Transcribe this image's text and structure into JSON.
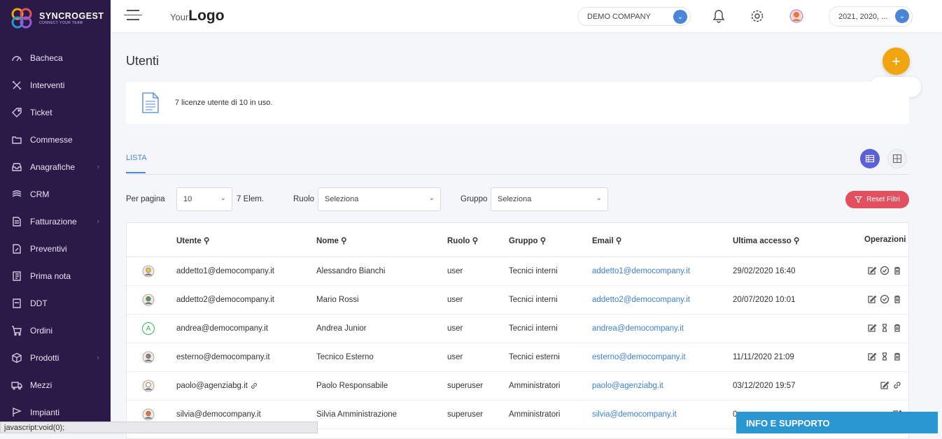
{
  "brand": {
    "name": "SYNCROGEST",
    "tagline": "CONNECT YOUR TEAM"
  },
  "sidebar": {
    "items": [
      {
        "label": "Bacheca",
        "icon": "dashboard-icon",
        "chevron": false
      },
      {
        "label": "Interventi",
        "icon": "tools-icon",
        "chevron": false
      },
      {
        "label": "Ticket",
        "icon": "tag-icon",
        "chevron": false
      },
      {
        "label": "Commesse",
        "icon": "folder-icon",
        "chevron": false
      },
      {
        "label": "Anagrafiche",
        "icon": "inbox-icon",
        "chevron": true
      },
      {
        "label": "CRM",
        "icon": "crm-icon",
        "chevron": false
      },
      {
        "label": "Fatturazione",
        "icon": "document-icon",
        "chevron": true
      },
      {
        "label": "Preventivi",
        "icon": "edit-doc-icon",
        "chevron": false
      },
      {
        "label": "Prima nota",
        "icon": "notebook-icon",
        "chevron": false
      },
      {
        "label": "DDT",
        "icon": "ddt-icon",
        "chevron": false
      },
      {
        "label": "Ordini",
        "icon": "cart-icon",
        "chevron": false
      },
      {
        "label": "Prodotti",
        "icon": "box-icon",
        "chevron": true
      },
      {
        "label": "Mezzi",
        "icon": "truck-icon",
        "chevron": false
      },
      {
        "label": "Impianti",
        "icon": "flag-icon",
        "chevron": false
      }
    ]
  },
  "topbar": {
    "logo_light": "Your",
    "logo_bold": "Logo",
    "company": "DEMO COMPANY",
    "years": "2021, 2020, ..."
  },
  "page": {
    "title": "Utenti",
    "new_label": "Nuovo",
    "license_text": "7 licenze utente di 10 in uso.",
    "tab": "LISTA"
  },
  "filters": {
    "per_page_label": "Per pagina",
    "per_page_value": "10",
    "elements": "7 Elem.",
    "role_label": "Ruolo",
    "role_value": "Seleziona",
    "group_label": "Gruppo",
    "group_value": "Seleziona",
    "reset_label": "Reset Filtri"
  },
  "table": {
    "headers": {
      "user": "Utente",
      "name": "Nome",
      "role": "Ruolo",
      "group": "Gruppo",
      "email": "Email",
      "last": "Ultima accesso",
      "ops": "Operazioni"
    },
    "rows": [
      {
        "user": "addetto1@democompany.it",
        "name": "Alessandro Bianchi",
        "role": "user",
        "group": "Tecnici interni",
        "email": "addetto1@democompany.it",
        "last": "29/02/2020 16:40"
      },
      {
        "user": "addetto2@democompany.it",
        "name": "Mario Rossi",
        "role": "user",
        "group": "Tecnici interni",
        "email": "addetto2@democompany.it",
        "last": "20/07/2020 10:01"
      },
      {
        "user": "andrea@democompany.it",
        "name": "Andrea Junior",
        "role": "user",
        "group": "Tecnici interni",
        "email": "andrea@democompany.it",
        "last": ""
      },
      {
        "user": "esterno@democompany.it",
        "name": "Tecnico Esterno",
        "role": "user",
        "group": "Tecnici esterni",
        "email": "esterno@democompany.it",
        "last": "11/11/2020 21:09"
      },
      {
        "user": "paolo@agenziabg.it",
        "name": "Paolo Responsabile",
        "role": "superuser",
        "group": "Amministratori",
        "email": "paolo@agenziabg.it",
        "last": "03/12/2020 19:57"
      },
      {
        "user": "silvia@democompany.it",
        "name": "Silvia Amministrazione",
        "role": "superuser",
        "group": "Amministratori",
        "email": "silvia@democompany.it",
        "last": "0"
      }
    ]
  },
  "statusbar": "javascript:void(0);",
  "support": "INFO E SUPPORTO",
  "colors": {
    "sidebar": "#2b1a47",
    "accent": "#4a86d8",
    "fab": "#f0a510",
    "reset": "#e2505f",
    "support": "#2a96d2"
  }
}
